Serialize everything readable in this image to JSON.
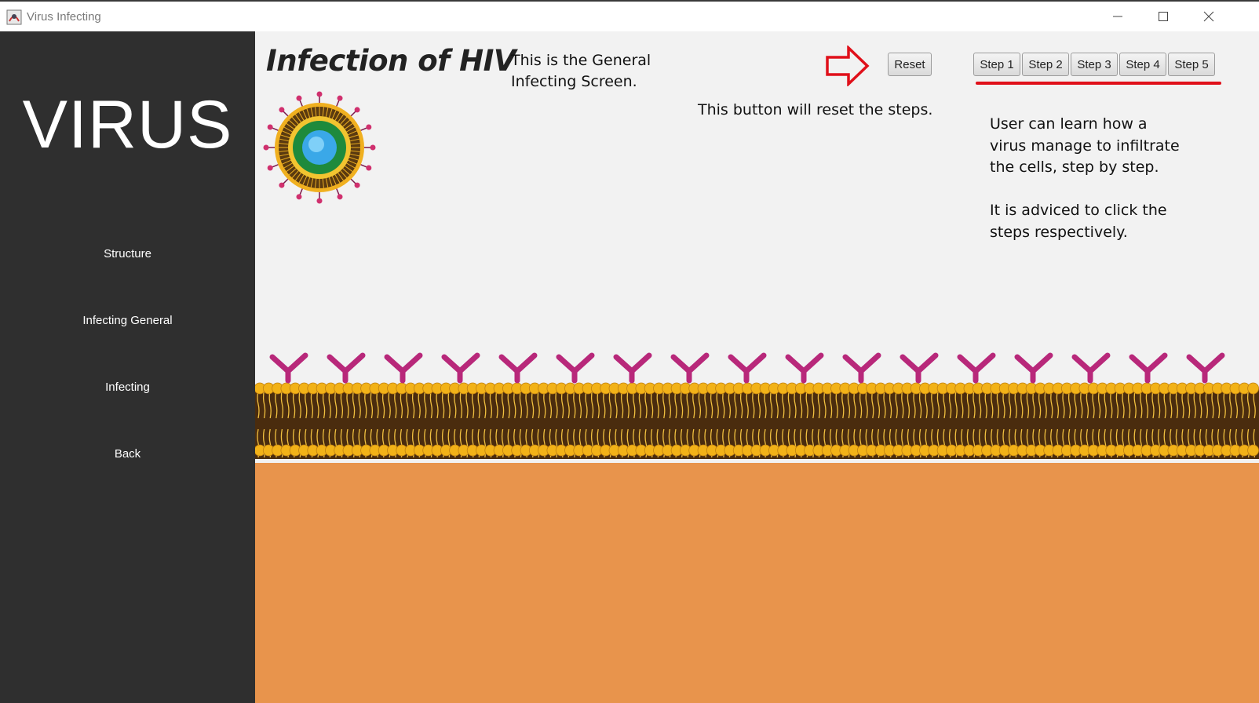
{
  "window": {
    "title": "Virus Infecting",
    "icon": "java-app-icon",
    "controls": [
      "minimize-icon",
      "maximize-icon",
      "close-icon"
    ]
  },
  "sidebar": {
    "brand": "VIRUS",
    "items": [
      {
        "label": "Structure"
      },
      {
        "label": "Infecting General"
      },
      {
        "label": "Infecting"
      },
      {
        "label": "Back"
      }
    ]
  },
  "main": {
    "heading": "Infection of HIV",
    "intro_line1": "This is the General",
    "intro_line2": "Infecting Screen.",
    "reset_label": "Reset",
    "reset_hint": "This button will reset the steps.",
    "steps": [
      {
        "label": "Step 1"
      },
      {
        "label": "Step 2"
      },
      {
        "label": "Step 3"
      },
      {
        "label": "Step 4"
      },
      {
        "label": "Step 5"
      }
    ],
    "info_line1": "User can learn how a",
    "info_line2": "virus manage to infiltrate",
    "info_line3": "the cells, step by step.",
    "advice_line1": "It is adviced to click the",
    "advice_line2": "steps respectively."
  },
  "colors": {
    "sidebar_bg": "#2f2f2f",
    "content_bg": "#f2f2f2",
    "accent_red": "#e0101a",
    "cytoplasm": "#e8944c",
    "lipid_head": "#f0b020",
    "receptor": "#c0287a"
  }
}
